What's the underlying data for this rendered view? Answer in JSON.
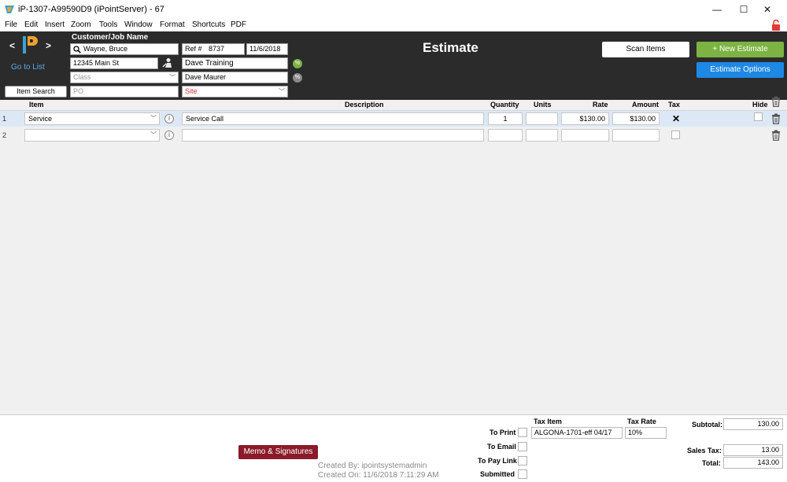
{
  "window": {
    "title": "iP-1307-A99590D9 (iPointServer) - 67",
    "min_glyph": "—",
    "max_glyph": "☐",
    "close_glyph": "✕"
  },
  "menu": [
    "File",
    "Edit",
    "Insert",
    "Zoom",
    "Tools",
    "Window",
    "Format",
    "Shortcuts",
    "PDF"
  ],
  "nav": {
    "prev": "<",
    "next": ">",
    "go_to_list": "Go to List",
    "item_search": "Item Search"
  },
  "header": {
    "customer_label": "Customer/Job Name",
    "customer_value": "Wayne, Bruce",
    "address": "12345 Main St",
    "class_placeholder": "Class",
    "po_placeholder": "PO",
    "ref_label": "Ref #",
    "ref_value": "8737",
    "date": "11/6/2018",
    "rep1": "Dave Training",
    "rep2": "Dave Maurer",
    "site_placeholder": "Site",
    "page_title": "Estimate",
    "scan_items": "Scan Items",
    "new_estimate": "+ New Estimate",
    "estimate_options": "Estimate Options"
  },
  "columns": {
    "item": "Item",
    "description": "Description",
    "quantity": "Quantity",
    "units": "Units",
    "rate": "Rate",
    "amount": "Amount",
    "tax": "Tax",
    "hide": "Hide"
  },
  "rows": [
    {
      "num": "1",
      "item": "Service",
      "description": "Service Call",
      "quantity": "1",
      "units": "",
      "rate": "$130.00",
      "amount": "$130.00",
      "tax": "✕"
    },
    {
      "num": "2",
      "item": "",
      "description": "",
      "quantity": "",
      "units": "",
      "rate": "",
      "amount": "",
      "tax": ""
    }
  ],
  "footer": {
    "memo_button": "Memo & Signatures",
    "created_by": "Created By: ipointsystemadmin",
    "created_on": "Created On: 11/6/2018 7:11:29 AM",
    "to_print": "To Print",
    "to_email": "To Email",
    "to_pay_link": "To Pay Link",
    "submitted": "Submitted",
    "tax_item_label": "Tax Item",
    "tax_item_value": "ALGONA-1701-eff 04/17",
    "tax_rate_label": "Tax Rate",
    "tax_rate_value": "10%",
    "subtotal_label": "Subtotal:",
    "subtotal_value": "130.00",
    "sales_tax_label": "Sales Tax:",
    "sales_tax_value": "13.00",
    "total_label": "Total:",
    "total_value": "143.00"
  },
  "colors": {
    "header_bg": "#2b2b2b",
    "green_button": "#7cb342",
    "blue_button": "#1e88e5",
    "memo_button": "#8b1a2a",
    "lock_red": "#e53935",
    "site_red": "#d32f2f"
  }
}
